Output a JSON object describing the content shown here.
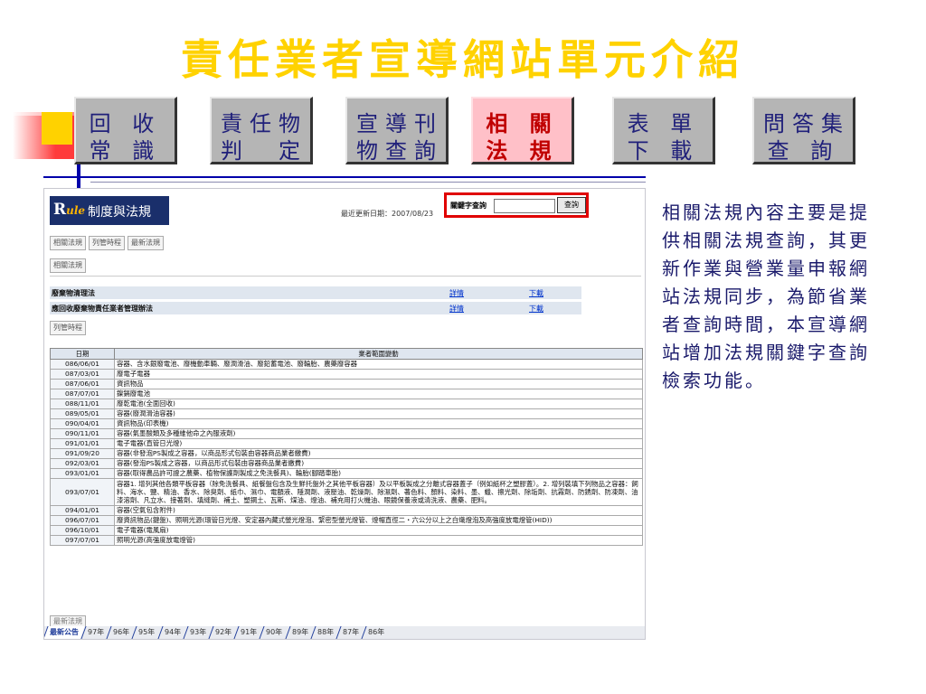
{
  "slide_title": "責任業者宣導網站單元介紹",
  "nav": [
    {
      "line1": "回 收",
      "line2": "常 識",
      "active": false
    },
    {
      "line1": "責任物",
      "line2": "判　定",
      "active": false
    },
    {
      "line1": "宣導刊",
      "line2": "物查詢",
      "active": false
    },
    {
      "line1": "相 關",
      "line2": "法 規",
      "active": true
    },
    {
      "line1": "表 單",
      "line2": "下 載",
      "active": false
    },
    {
      "line1": "問答集",
      "line2": "查 詢",
      "active": false
    }
  ],
  "panel": {
    "logo_letter": "R",
    "logo_sub": "ule",
    "banner_title": "制度與法規",
    "last_update": "最近更新日期：2007/08/23",
    "search_label": "關鍵字查詢",
    "search_value": "",
    "search_button": "查詢",
    "tabs": [
      "相關法規",
      "列管時程",
      "最新法規"
    ],
    "laws_tab": "相關法規",
    "laws": [
      {
        "name": "廢棄物清理法",
        "detail": "詳情",
        "download": "下載"
      },
      {
        "name": "應回收廢棄物責任業者管理辦法",
        "detail": "詳情",
        "download": "下載"
      }
    ],
    "schedule_tab": "列管時程",
    "table_headers": [
      "日期",
      "業者範圍變動"
    ],
    "rows": [
      {
        "date": "086/06/01",
        "desc": "容器、含水銀廢電池、廢機動車輛、廢潤滑油、廢鉛蓄電池、廢輪胎、農藥廢容器"
      },
      {
        "date": "087/03/01",
        "desc": "廢電子電器"
      },
      {
        "date": "087/06/01",
        "desc": "資訊物品"
      },
      {
        "date": "087/07/01",
        "desc": "鎳鎘廢電池"
      },
      {
        "date": "088/11/01",
        "desc": "廢乾電池(全面回收)"
      },
      {
        "date": "089/05/01",
        "desc": "容器(廢潤滑油容器)"
      },
      {
        "date": "090/04/01",
        "desc": "資訊物品(印表機)"
      },
      {
        "date": "090/11/01",
        "desc": "容器(氣墨酸類及多種維他命之內服液劑)"
      },
      {
        "date": "091/01/01",
        "desc": "電子電器(直管日光燈)"
      },
      {
        "date": "091/09/20",
        "desc": "容器(非發泡PS製成之容器，以商品形式包裝由容器商品業者繳費)"
      },
      {
        "date": "092/03/01",
        "desc": "容器(發泡PS製成之容器，以商品形式包裝由容器商品業者繳費)"
      },
      {
        "date": "093/01/01",
        "desc": "容器(取得農品許可證之農藥、植物保護劑製成之免洗餐具)、輪胎(腳踏車胎)"
      },
      {
        "date": "093/07/01",
        "desc": "容器1. 增列其他各類平板容器（除免洗餐具、紙餐盤包含及生鮮托盤外之其他平板容器）及以平板製成之分離式容器蓋子（例如紙杯之塑膠蓋）。2. 增列裝填下列物品之容器：飼料、海水、鹽、精油、香水、除臭劑、紙巾、濕巾、電額液、隱潤劑、液壓油、乾燥劑、除濕劑、著色料、顏料、染料、墨、蠟、擦光劑、除垢劑、抗霧劑、防銹劑、防凍劑、油漆溶劑、凡立水、接著劑、填縫劑、補土、塑鋼土、瓦斯、煤油、燈油、補充用打火機油、眼鏡保養液或清洗液、農藥、肥料。"
      },
      {
        "date": "094/01/01",
        "desc": "容器(空氣包含附件)"
      },
      {
        "date": "096/07/01",
        "desc": "廢資訊物品(鍵盤)、照明光源(環管日光燈、安定器內藏式螢光燈泡、緊密型螢光燈管、燈帽直徑二・六公分以上之白熾燈泡及高強度放電燈管(HID))"
      },
      {
        "date": "096/10/01",
        "desc": "電子電器(電風扇)"
      },
      {
        "date": "097/07/01",
        "desc": "照明光源(高強度放電燈管)"
      }
    ],
    "latest_button": "最新法規",
    "year_tabs": [
      "最新公告",
      "97年",
      "96年",
      "95年",
      "94年",
      "93年",
      "92年",
      "91年",
      "90年",
      "89年",
      "88年",
      "87年",
      "86年"
    ]
  },
  "description": "相關法規內容主要是提供相關法規查詢，其更新作業與營業量申報網站法規同步，為節省業者查詢時間，本宣導網站增加法規關鍵字查詢檢索功能。"
}
